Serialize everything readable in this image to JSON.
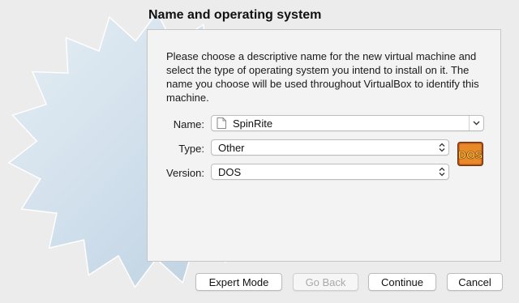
{
  "dialog": {
    "title": "Name and operating system",
    "description": "Please choose a descriptive name for the new virtual machine and select the type of operating system you intend to install on it. The name you choose will be used throughout VirtualBox to identify this machine."
  },
  "form": {
    "name_label": "Name:",
    "name_value": "SpinRite",
    "type_label": "Type:",
    "type_value": "Other",
    "version_label": "Version:",
    "version_value": "DOS",
    "os_icon_text": "DOS"
  },
  "buttons": {
    "expert": "Expert Mode",
    "back": "Go Back",
    "continue": "Continue",
    "cancel": "Cancel"
  },
  "colors": {
    "window_bg": "#ececec",
    "panel_bg": "#f3f3f3",
    "starburst": "#c9dceb",
    "dos_icon_orange": "#e8892a",
    "dos_icon_text": "#f2d24a"
  }
}
